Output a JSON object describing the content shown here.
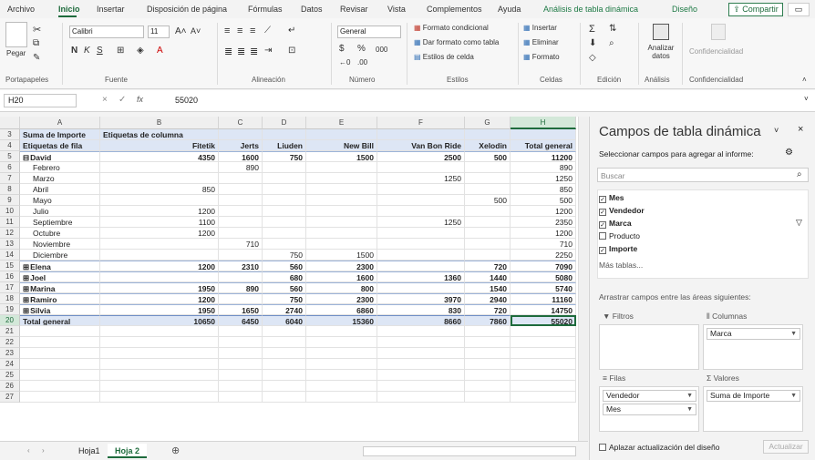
{
  "ribbon_tabs": [
    "Archivo",
    "Inicio",
    "Insertar",
    "Disposición de página",
    "Fórmulas",
    "Datos",
    "Revisar",
    "Vista",
    "Complementos",
    "Ayuda",
    "Análisis de tabla dinámica",
    "Diseño"
  ],
  "share_label": "Compartir",
  "clipboard": {
    "paste": "Pegar",
    "label": "Portapapeles"
  },
  "font": {
    "name": "Calibri",
    "size": "11",
    "label": "Fuente"
  },
  "alignment": {
    "label": "Alineación"
  },
  "number": {
    "format": "General",
    "label": "Número"
  },
  "styles": {
    "cond": "Formato condicional",
    "table": "Dar formato como tabla",
    "cell": "Estilos de celda",
    "label": "Estilos"
  },
  "cells": {
    "insert": "Insertar",
    "delete": "Eliminar",
    "format": "Formato",
    "label": "Celdas"
  },
  "editing": {
    "label": "Edición"
  },
  "analysis": {
    "btn": "Analizar datos",
    "label": "Análisis"
  },
  "confidentiality": {
    "btn": "Confidencialidad",
    "label": "Confidencialidad"
  },
  "formula_bar": {
    "namebox": "H20",
    "fx": "fx",
    "value": "55020"
  },
  "columns": [
    "A",
    "B",
    "C",
    "D",
    "E",
    "F",
    "G",
    "H"
  ],
  "row_numbers": [
    "3",
    "4",
    "5",
    "6",
    "7",
    "8",
    "9",
    "10",
    "11",
    "12",
    "13",
    "14",
    "15",
    "16",
    "17",
    "18",
    "19",
    "20",
    "21",
    "22",
    "23",
    "24",
    "25",
    "26",
    "27"
  ],
  "pivot": {
    "r3": [
      "Suma de Importe",
      "Etiquetas de columna"
    ],
    "r4": [
      "Etiquetas de fila",
      "Fitetik",
      "Jerts",
      "Liuden",
      "New Bill",
      "Van Bon Ride",
      "Xelodin",
      "Total general"
    ],
    "rows": [
      [
        "David",
        "4350",
        "1600",
        "750",
        "1500",
        "2500",
        "500",
        "11200"
      ],
      [
        "Febrero",
        "",
        "890",
        "",
        "",
        "",
        "",
        "890"
      ],
      [
        "Marzo",
        "",
        "",
        "",
        "",
        "1250",
        "",
        "1250"
      ],
      [
        "Abril",
        "850",
        "",
        "",
        "",
        "",
        "",
        "850"
      ],
      [
        "Mayo",
        "",
        "",
        "",
        "",
        "",
        "500",
        "500"
      ],
      [
        "Julio",
        "1200",
        "",
        "",
        "",
        "",
        "",
        "1200"
      ],
      [
        "Septiembre",
        "1100",
        "",
        "",
        "",
        "1250",
        "",
        "2350"
      ],
      [
        "Octubre",
        "1200",
        "",
        "",
        "",
        "",
        "",
        "1200"
      ],
      [
        "Noviembre",
        "",
        "710",
        "",
        "",
        "",
        "",
        "710"
      ],
      [
        "Diciembre",
        "",
        "",
        "750",
        "1500",
        "",
        "",
        "2250"
      ],
      [
        "Elena",
        "1200",
        "2310",
        "560",
        "2300",
        "",
        "720",
        "7090"
      ],
      [
        "Joel",
        "",
        "",
        "680",
        "1600",
        "1360",
        "1440",
        "5080"
      ],
      [
        "Marina",
        "1950",
        "890",
        "560",
        "800",
        "",
        "1540",
        "5740"
      ],
      [
        "Ramiro",
        "1200",
        "",
        "750",
        "2300",
        "3970",
        "2940",
        "11160"
      ],
      [
        "Silvia",
        "1950",
        "1650",
        "2740",
        "6860",
        "830",
        "720",
        "14750"
      ],
      [
        "Total general",
        "10650",
        "6450",
        "6040",
        "15360",
        "8660",
        "7860",
        "55020"
      ]
    ]
  },
  "sheets": [
    "Hoja1",
    "Hoja 2"
  ],
  "pane": {
    "title": "Campos de tabla dinámica",
    "subtitle": "Seleccionar campos para agregar al informe:",
    "search_placeholder": "Buscar",
    "fields": [
      "Mes",
      "Vendedor",
      "Marca",
      "Producto",
      "Importe"
    ],
    "more_tables": "Más tablas...",
    "drag_text": "Arrastrar campos entre las áreas siguientes:",
    "filters": "Filtros",
    "columns": "Columnas",
    "rows": "Filas",
    "values": "Valores",
    "col_field": "Marca",
    "row_fields": [
      "Vendedor",
      "Mes"
    ],
    "value_field": "Suma de Importe",
    "defer": "Aplazar actualización del diseño",
    "update": "Actualizar"
  }
}
